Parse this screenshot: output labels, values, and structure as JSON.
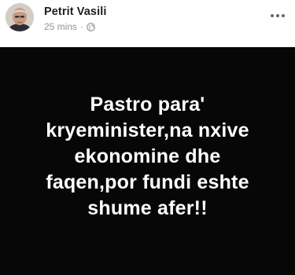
{
  "post": {
    "author_name": "Petrit Vasili",
    "time": "25 mins",
    "separator": "·",
    "privacy_icon": "globe-icon",
    "more_icon": "more-options-icon",
    "status_text": "Pastro para'\nkryeminister,na nxive\nekonomine dhe\nfaqen,por fundi eshte\nshume afer!!",
    "background_color": "#070707",
    "text_color": "#ffffff"
  }
}
